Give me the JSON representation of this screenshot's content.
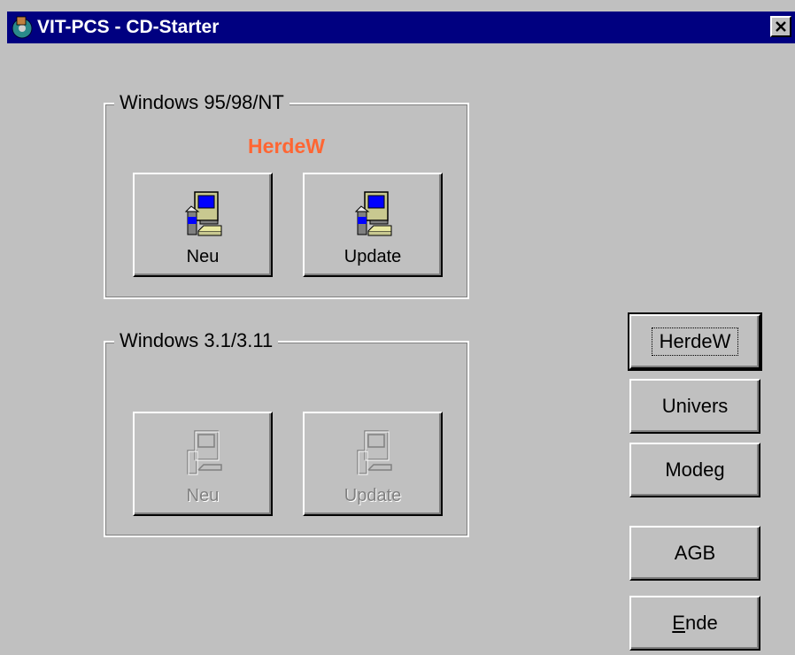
{
  "window": {
    "title": "VIT-PCS - CD-Starter",
    "close_label": "✕"
  },
  "group_win95": {
    "legend": "Windows 95/98/NT",
    "product_label": "HerdeW",
    "buttons": [
      {
        "label": "Neu"
      },
      {
        "label": "Update"
      }
    ]
  },
  "group_win31": {
    "legend": "Windows 3.1/3.11",
    "buttons": [
      {
        "label": "Neu",
        "disabled": true
      },
      {
        "label": "Update",
        "disabled": true
      }
    ]
  },
  "side_buttons": [
    {
      "label": "HerdeW"
    },
    {
      "label": "Univers"
    },
    {
      "label": "Modeg"
    },
    {
      "label": "AGB"
    },
    {
      "label": "Ende",
      "mnemonic": "E"
    }
  ],
  "colors": {
    "title_bar": "#000080",
    "face": "#c0c0c0",
    "product_label": "#ff6633"
  }
}
